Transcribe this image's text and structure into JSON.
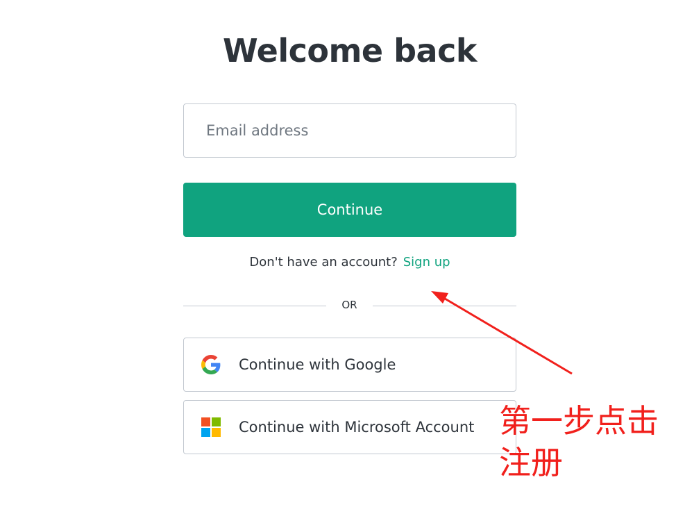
{
  "page": {
    "title": "Welcome back"
  },
  "login_form": {
    "email_placeholder": "Email address",
    "continue_label": "Continue",
    "signup_prompt": "Don't have an account?",
    "signup_link": "Sign up",
    "divider_text": "OR"
  },
  "social": {
    "google_label": "Continue with Google",
    "google_icon": "google-icon",
    "microsoft_label": "Continue with Microsoft Account",
    "microsoft_icon": "microsoft-icon"
  },
  "annotation": {
    "text": "第一步点击注册",
    "color": "#f1201c"
  },
  "colors": {
    "accent": "#10a37f",
    "text": "#2d333a",
    "border": "#c2c8d0"
  }
}
